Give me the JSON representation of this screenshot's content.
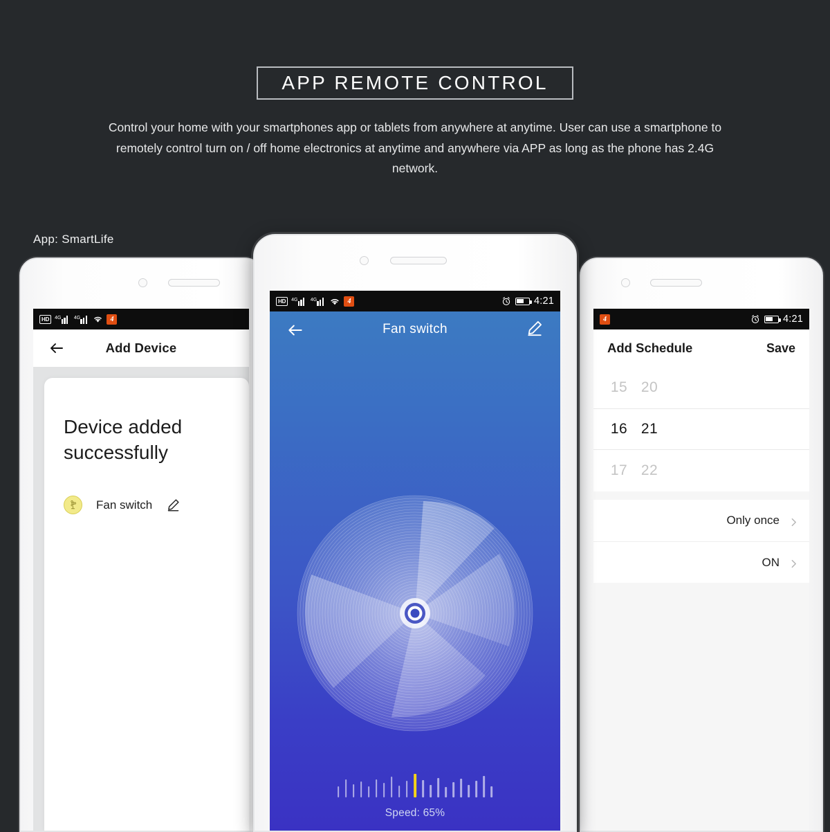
{
  "header": {
    "title": "APP REMOTE CONTROL",
    "description": "Control your home with your smartphones app or tablets from anywhere at anytime. User can use a smartphone to remotely control turn on / off home electronics at anytime and anywhere via APP as long as the phone has 2.4G network.",
    "app_label": "App: SmartLife"
  },
  "colors": {
    "background": "#26292c",
    "title_border": "#b9bcc0",
    "accent_blue_top": "#3d7dc1",
    "accent_blue_bottom": "#3a32c3",
    "slider_marker": "#f5d318",
    "status_app_icon": "#e04e12",
    "fan_badge": "#f2ea8a"
  },
  "status_bar": {
    "hd": "HD",
    "network_label": "4G",
    "time": "4:21",
    "icons": [
      "hd-icon",
      "signal-4g-icon",
      "signal-4g-icon",
      "wifi-icon",
      "app-orange-icon",
      "alarm-icon",
      "battery-icon"
    ]
  },
  "phone_left": {
    "screen_name": "add-device",
    "header_title": "Add Device",
    "success_message": "Device added successfully",
    "device_name": "Fan switch"
  },
  "phone_center": {
    "screen_name": "fan-switch",
    "header_title": "Fan switch",
    "speed_label": "Speed: 65%",
    "speed_percent": 65,
    "tick_count": 21,
    "active_tick_index": 10
  },
  "phone_right": {
    "screen_name": "add-schedule",
    "header_title": "Add Schedule",
    "save_label": "Save",
    "picker": [
      {
        "hour": "15",
        "minute": "20",
        "selected": false
      },
      {
        "hour": "16",
        "minute": "21",
        "selected": true
      },
      {
        "hour": "17",
        "minute": "22",
        "selected": false
      }
    ],
    "options": [
      {
        "label": "Only once"
      },
      {
        "label": "ON"
      }
    ]
  }
}
